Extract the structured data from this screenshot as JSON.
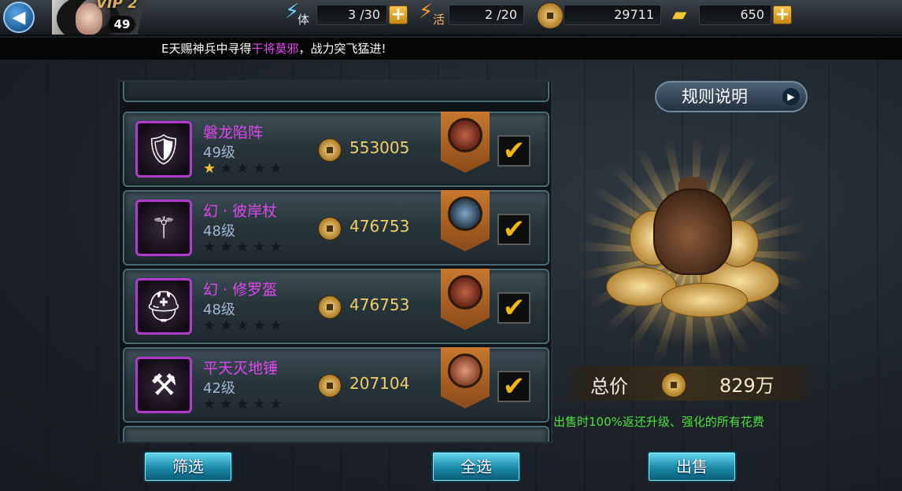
{
  "header": {
    "vip": "VIP 2",
    "level": "49",
    "stamina": {
      "label": "体",
      "value": "3 /30"
    },
    "energy": {
      "label": "活",
      "value": "2 /20"
    },
    "coins": "29711",
    "gold": "650"
  },
  "ticker": {
    "prefix": "E天赐神兵中寻得",
    "highlight": "干将莫邪",
    "suffix": "，战力突飞猛进!"
  },
  "items": [
    {
      "name": "磐龙陷阵",
      "level": "49级",
      "price": "553005",
      "stars": 1
    },
    {
      "name": "幻 · 彼岸杖",
      "level": "48级",
      "price": "476753",
      "stars": 0
    },
    {
      "name": "幻 · 修罗盔",
      "level": "48级",
      "price": "476753",
      "stars": 0
    },
    {
      "name": "平天灭地锤",
      "level": "42级",
      "price": "207104",
      "stars": 0
    }
  ],
  "buttons": {
    "filter": "筛选",
    "select_all": "全选",
    "sell": "出售",
    "rules": "规则说明"
  },
  "summary": {
    "total_label": "总价",
    "total_value": "829万",
    "note": "出售时100%返还升级、强化的所有花费"
  },
  "colors": {
    "item_name": "#e247ef",
    "note": "#4de33f",
    "price": "#f0cf6a"
  }
}
